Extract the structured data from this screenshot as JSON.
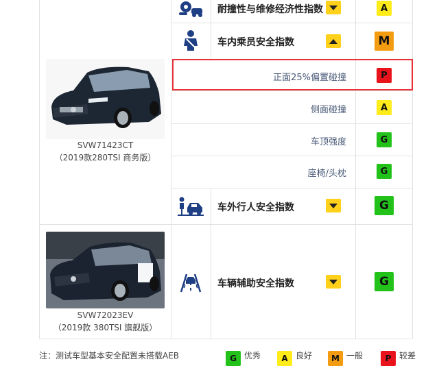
{
  "rows": {
    "durability": {
      "label": "耐撞性与维修经济性指数",
      "rating": "A",
      "rating_color": "#ffec1a"
    },
    "occupant": {
      "label": "车内乘员安全指数",
      "rating": "M",
      "rating_color": "#f39c12"
    },
    "sub_items": [
      {
        "label": "正面25%偏置碰撞",
        "rating": "P",
        "rating_color": "#e8131b"
      },
      {
        "label": "侧面碰撞",
        "rating": "A",
        "rating_color": "#ffec1a"
      },
      {
        "label": "车顶强度",
        "rating": "G",
        "rating_color": "#22c21a"
      },
      {
        "label": "座椅/头枕",
        "rating": "G",
        "rating_color": "#22c21a"
      }
    ],
    "pedestrian": {
      "label": "车外行人安全指数",
      "rating": "G",
      "rating_color": "#22c21a"
    },
    "assist": {
      "label": "车辆辅助安全指数",
      "rating": "G",
      "rating_color": "#22c21a"
    }
  },
  "cars": [
    {
      "code": "SVW71423CT",
      "desc": "（2019款280TSI 商务版）"
    },
    {
      "code": "SVW72023EV",
      "desc": "（2019款 380TSI 旗舰版）"
    }
  ],
  "icons": {
    "durability": "wrench-gear-car-icon",
    "occupant": "seated-occupant-icon",
    "pedestrian": "pedestrian-car-icon",
    "assist": "lane-assist-icon"
  },
  "footer": {
    "note": "注：测试车型基本安全配置未搭载AEB",
    "legend": [
      {
        "code": "G",
        "label": "优秀",
        "color": "#22c21a"
      },
      {
        "code": "A",
        "label": "良好",
        "color": "#ffec1a"
      },
      {
        "code": "M",
        "label": "一般",
        "color": "#f39c12"
      },
      {
        "code": "P",
        "label": "较差",
        "color": "#e8131b"
      }
    ]
  }
}
